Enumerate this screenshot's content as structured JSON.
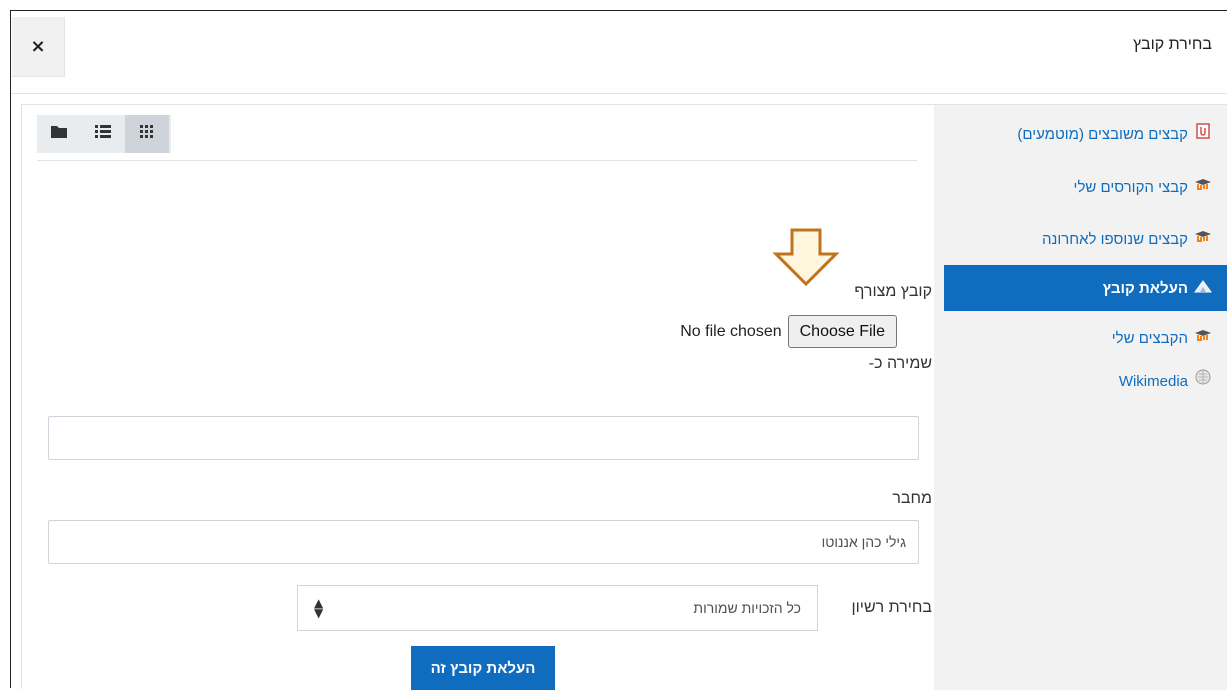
{
  "dialog": {
    "title": "בחירת קובץ",
    "close_label": "×"
  },
  "sidebar": {
    "items": [
      {
        "label": "קבצים משובצים (מוטמעים)",
        "icon": "clip-icon"
      },
      {
        "label": "קבצי הקורסים שלי",
        "icon": "mortarboard-icon"
      },
      {
        "label": "קבצים שנוספו לאחרונה",
        "icon": "mortarboard-icon"
      },
      {
        "label": "העלאת קובץ",
        "icon": "upload-icon",
        "active": true
      },
      {
        "label": "הקבצים שלי",
        "icon": "mortarboard-icon"
      },
      {
        "label": "Wikimedia",
        "icon": "wikimedia-icon"
      }
    ]
  },
  "toolbar": {
    "views": [
      "grid-icon",
      "list-icon",
      "folder-icon"
    ]
  },
  "form": {
    "attachment_label": "קובץ מצורף",
    "choose_file_label": "Choose File",
    "no_file_text": "No file chosen",
    "save_as_label": "שמירה כ-",
    "save_as_value": "",
    "author_label": "מחבר",
    "author_value": "גילי כהן אננוטו",
    "license_label": "בחירת רשיון",
    "license_value": "כל הזכויות שמורות",
    "upload_button": "העלאת קובץ זה"
  },
  "colors": {
    "accent": "#0f6cbf",
    "arrow": "#c0731f",
    "arrow_fill": "#fff6dd"
  }
}
